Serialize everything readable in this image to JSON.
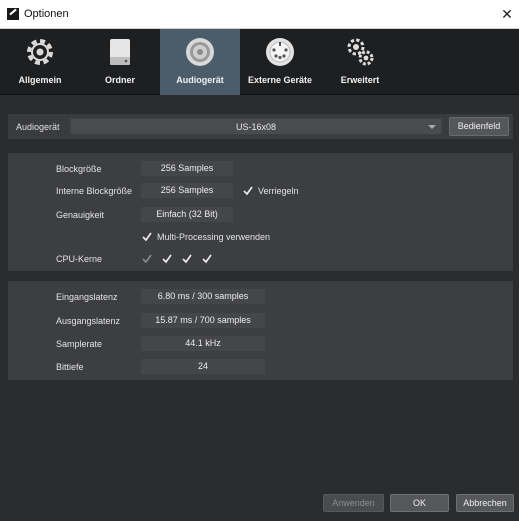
{
  "window": {
    "title": "Optionen",
    "close_glyph": "✕"
  },
  "tabs": [
    {
      "label": "Allgemein",
      "icon": "gear-icon"
    },
    {
      "label": "Ordner",
      "icon": "drive-icon"
    },
    {
      "label": "Audiogerät",
      "icon": "speaker-icon",
      "active": true
    },
    {
      "label": "Externe Geräte",
      "icon": "midi-connector-icon"
    },
    {
      "label": "Erweitert",
      "icon": "gears-icon"
    }
  ],
  "device": {
    "label": "Audiogerät",
    "selected": "US-16x08",
    "panel_button": "Bedienfeld"
  },
  "settings": {
    "block_size": {
      "label": "Blockgröße",
      "value": "256 Samples"
    },
    "internal_block_size": {
      "label": "Interne Blockgröße",
      "value": "256 Samples",
      "lock_label": "Verriegeln",
      "lock_checked": true
    },
    "precision": {
      "label": "Genauigkeit",
      "value": "Einfach (32 Bit)"
    },
    "multiprocessing": {
      "label": "Multi-Processing verwenden",
      "checked": true
    },
    "cpu_cores": {
      "label": "CPU-Kerne",
      "cores": [
        true,
        true,
        true,
        true
      ],
      "first_disabled": true
    }
  },
  "info": {
    "input_latency": {
      "label": "Eingangslatenz",
      "value": "6.80 ms / 300 samples"
    },
    "output_latency": {
      "label": "Ausgangslatenz",
      "value": "15.87 ms / 700 samples"
    },
    "sample_rate": {
      "label": "Samplerate",
      "value": "44.1 kHz"
    },
    "bit_depth": {
      "label": "Bittiefe",
      "value": "24"
    }
  },
  "footer": {
    "apply": "Anwenden",
    "ok": "OK",
    "cancel": "Abbrechen"
  },
  "colors": {
    "active_tab": "#4b5d6b",
    "panel": "#3d3e42",
    "background": "#2b2c2f"
  }
}
